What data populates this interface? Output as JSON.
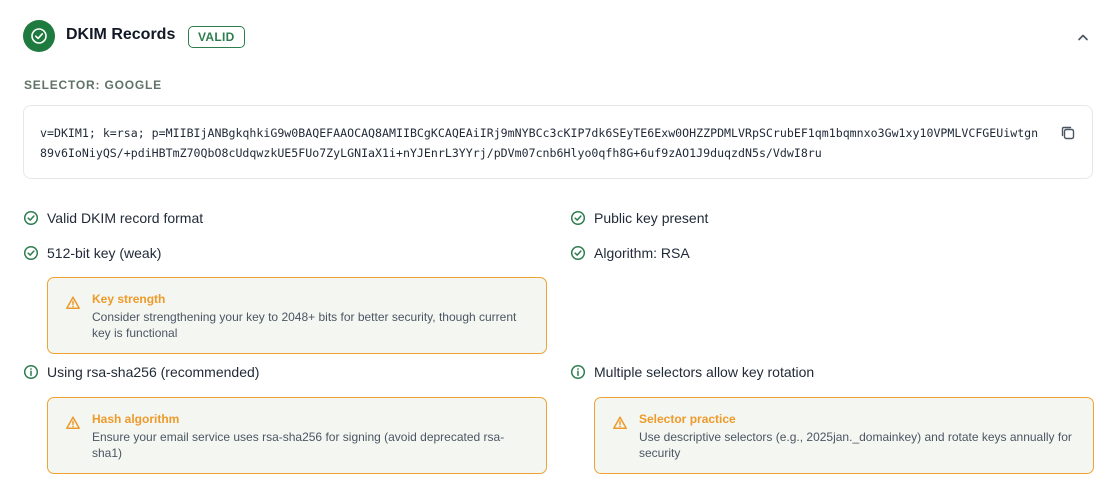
{
  "header": {
    "title": "DKIM Records",
    "badge": "VALID"
  },
  "selector": {
    "label": "SELECTOR: GOOGLE",
    "record": "v=DKIM1; k=rsa; p=MIIBIjANBgkqhkiG9w0BAQEFAAOCAQ8AMIIBCgKCAQEAiIRj9mNYBCc3cKIP7dk6SEyTE6Exw0OHZZPDMLVRpSCrubEF1qm1bqmnxo3Gw1xy10VPMLVCFGEUiwtgn89v6IoNiyQS/+pdiHBTmZ70QbO8cUdqwzkUE5FUo7ZyLGNIaX1i+nYJEnrL3YYrj/pDVm07cnb6Hlyo0qfh8G+6uf9zAO1J9duqzdN5s/VdwI8ru"
  },
  "checks": {
    "valid_format": "Valid DKIM record format",
    "public_key": "Public key present",
    "key_size": "512-bit key (weak)",
    "algorithm": "Algorithm: RSA",
    "hash": "Using rsa-sha256 (recommended)",
    "selectors": "Multiple selectors allow key rotation"
  },
  "alerts": {
    "key_strength": {
      "title": "Key strength",
      "body": "Consider strengthening your key to 2048+ bits for better security, though current key is functional"
    },
    "hash_algorithm": {
      "title": "Hash algorithm",
      "body": "Ensure your email service uses rsa-sha256 for signing (avoid deprecated rsa-sha1)"
    },
    "selector_practice": {
      "title": "Selector practice",
      "body": "Use descriptive selectors (e.g., 2025jan._domainkey) and rotate keys annually for security"
    }
  },
  "colors": {
    "success": "#2e7d4f",
    "warning": "#ee9a2b",
    "alert_bg": "#f4f7f1"
  },
  "icons": {
    "status": "check-circle-icon",
    "collapse": "chevron-up-icon",
    "copy": "copy-icon",
    "check": "check-circle-icon",
    "info": "info-icon",
    "warning": "warning-triangle-icon"
  }
}
